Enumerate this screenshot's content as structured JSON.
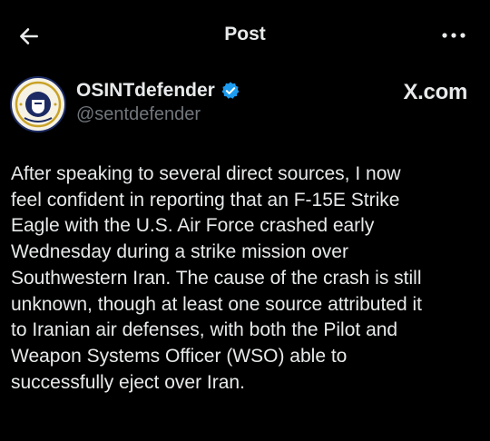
{
  "header": {
    "title": "Post",
    "back_icon": "arrow-left-icon",
    "more_icon": "more-horizontal-icon"
  },
  "author": {
    "display_name": "OSINTdefender",
    "handle": "@sentdefender",
    "verified_icon": "verified-badge-icon",
    "verified_color": "#1d9bf0"
  },
  "source_label": "X.com",
  "post": {
    "text": "After speaking to several direct sources, I now\nfeel confident in reporting that an F-15E Strike\nEagle with the U.S. Air Force crashed early\nWednesday during a strike mission over\nSouthwestern Iran. The cause of the crash is still\nunknown, though at least one source attributed it\nto Iranian air defenses, with both the Pilot and\nWeapon Systems Officer (WSO) able to\nsuccessfully eject over Iran."
  }
}
